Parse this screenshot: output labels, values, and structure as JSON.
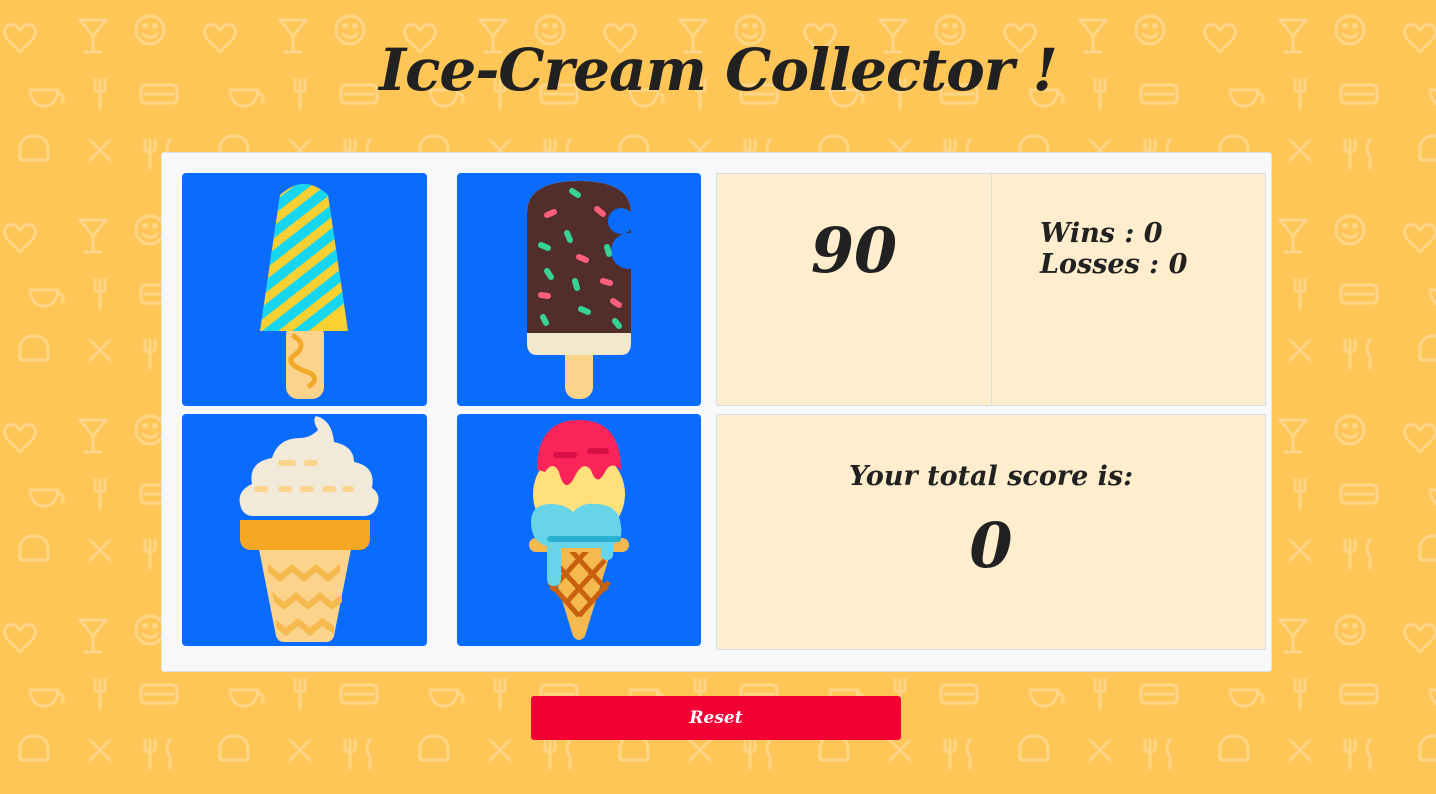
{
  "app": {
    "title": "Ice-Cream Collector !"
  },
  "colors": {
    "background": "#fec557",
    "tile": "#0a6cff",
    "panel": "#ffeece",
    "reset": "#f40034"
  },
  "tiles": [
    {
      "icon": "striped-popsicle-icon"
    },
    {
      "icon": "chocolate-sprinkle-popsicle-icon"
    },
    {
      "icon": "soft-serve-cone-icon"
    },
    {
      "icon": "three-scoop-cone-icon"
    }
  ],
  "target": {
    "value": "90"
  },
  "record": {
    "wins_label": "Wins",
    "wins": "0",
    "losses_label": "Losses",
    "losses": "0"
  },
  "score": {
    "label": "Your total score is:",
    "value": "0"
  },
  "reset": {
    "label": "Reset"
  }
}
